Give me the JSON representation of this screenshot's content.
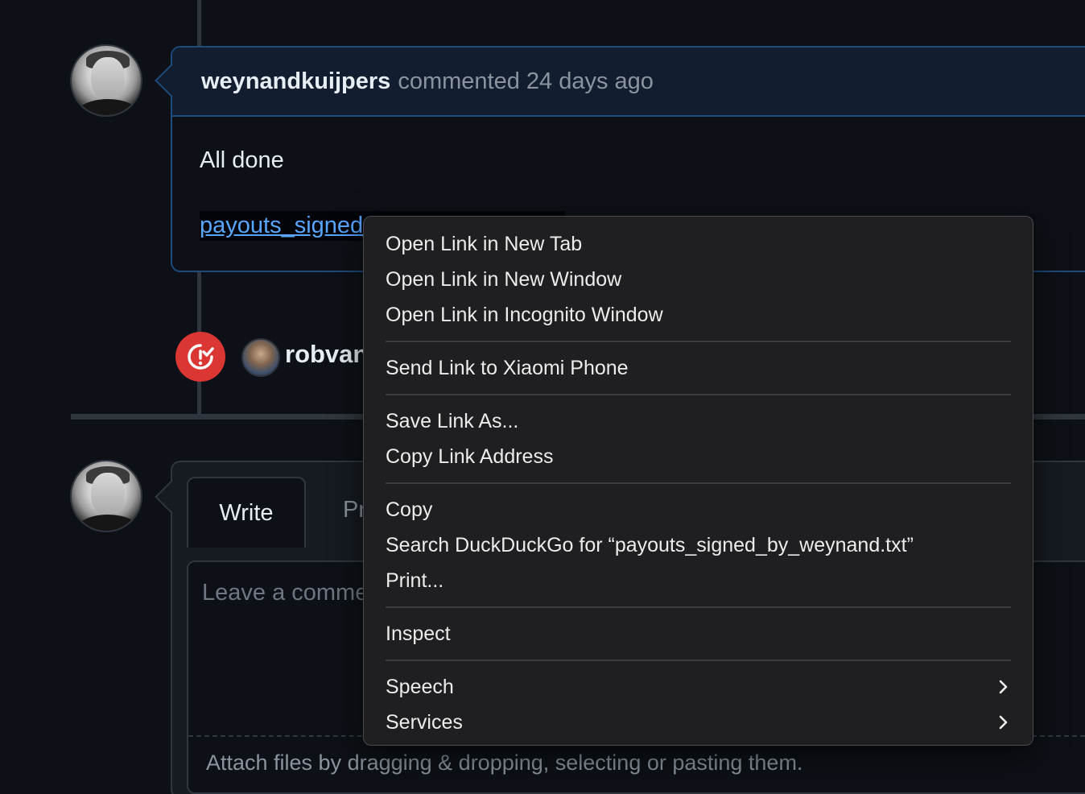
{
  "comment": {
    "author": "weynandkuijpers",
    "meta": "commented 24 days ago",
    "text": "All done",
    "link_text": "payouts_signed_by_weynand.txt"
  },
  "event": {
    "user": "robvanmieghem",
    "icon": "issue-closed-icon"
  },
  "new_comment": {
    "tab_write": "Write",
    "tab_preview": "Preview",
    "placeholder": "Leave a comment",
    "attach_text": "Attach files by dragging & dropping, selecting or pasting them."
  },
  "context_menu": {
    "groups": [
      [
        "Open Link in New Tab",
        "Open Link in New Window",
        "Open Link in Incognito Window"
      ],
      [
        "Send Link to Xiaomi Phone"
      ],
      [
        "Save Link As...",
        "Copy Link Address"
      ],
      [
        "Copy",
        "Search DuckDuckGo for “payouts_signed_by_weynand.txt”",
        "Print..."
      ],
      [
        "Inspect"
      ],
      [
        "Speech",
        "Services"
      ]
    ],
    "submenu_items": [
      "Speech",
      "Services"
    ]
  },
  "colors": {
    "background": "#0d1117",
    "accent_link": "#58a6ff",
    "closed_red": "#da3633",
    "comment_border": "#1f4a7a",
    "menu_bg": "#1f1f21"
  }
}
